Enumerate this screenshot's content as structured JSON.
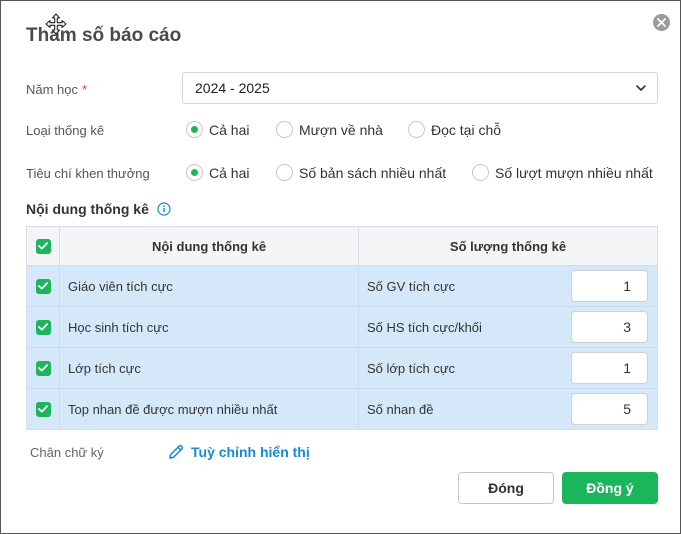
{
  "dialog": {
    "title": "Tham số báo cáo",
    "icons": {
      "move": "move-cursor-icon",
      "close": "close-icon"
    }
  },
  "form": {
    "school_year": {
      "label": "Năm học",
      "required_mark": "*",
      "value": "2024 - 2025"
    },
    "stat_type": {
      "label": "Loại thống kê",
      "options": [
        "Cả hai",
        "Mượn về nhà",
        "Đọc tại chỗ"
      ],
      "selected": 0
    },
    "reward_criteria": {
      "label": "Tiêu chí khen thưởng",
      "options": [
        "Cả hai",
        "Số bản sách nhiều nhất",
        "Số lượt mượn nhiều nhất"
      ],
      "selected": 0
    }
  },
  "section": {
    "title": "Nội dung thống kê"
  },
  "table": {
    "headers": [
      "Nội dung thống kê",
      "Số lượng thống kê"
    ],
    "rows": [
      {
        "content": "Giáo viên tích cực",
        "quantity_label": "Số GV tích cực",
        "value": "1"
      },
      {
        "content": "Học sinh tích cực",
        "quantity_label": "Số HS tích cực/khối",
        "value": "3"
      },
      {
        "content": "Lớp tích cực",
        "quantity_label": "Số lớp tích cực",
        "value": "1"
      },
      {
        "content": "Top nhan đề được mượn nhiều nhất",
        "quantity_label": "Số nhan đề",
        "value": "5"
      }
    ]
  },
  "footer": {
    "signature_label": "Chân chữ ký",
    "customize_link": "Tuỳ chỉnh hiển thị",
    "close_button": "Đóng",
    "ok_button": "Đồng ý"
  },
  "colors": {
    "accent": "#1bb55c",
    "link": "#1a88d4",
    "row_bg": "#d5e8fa"
  }
}
